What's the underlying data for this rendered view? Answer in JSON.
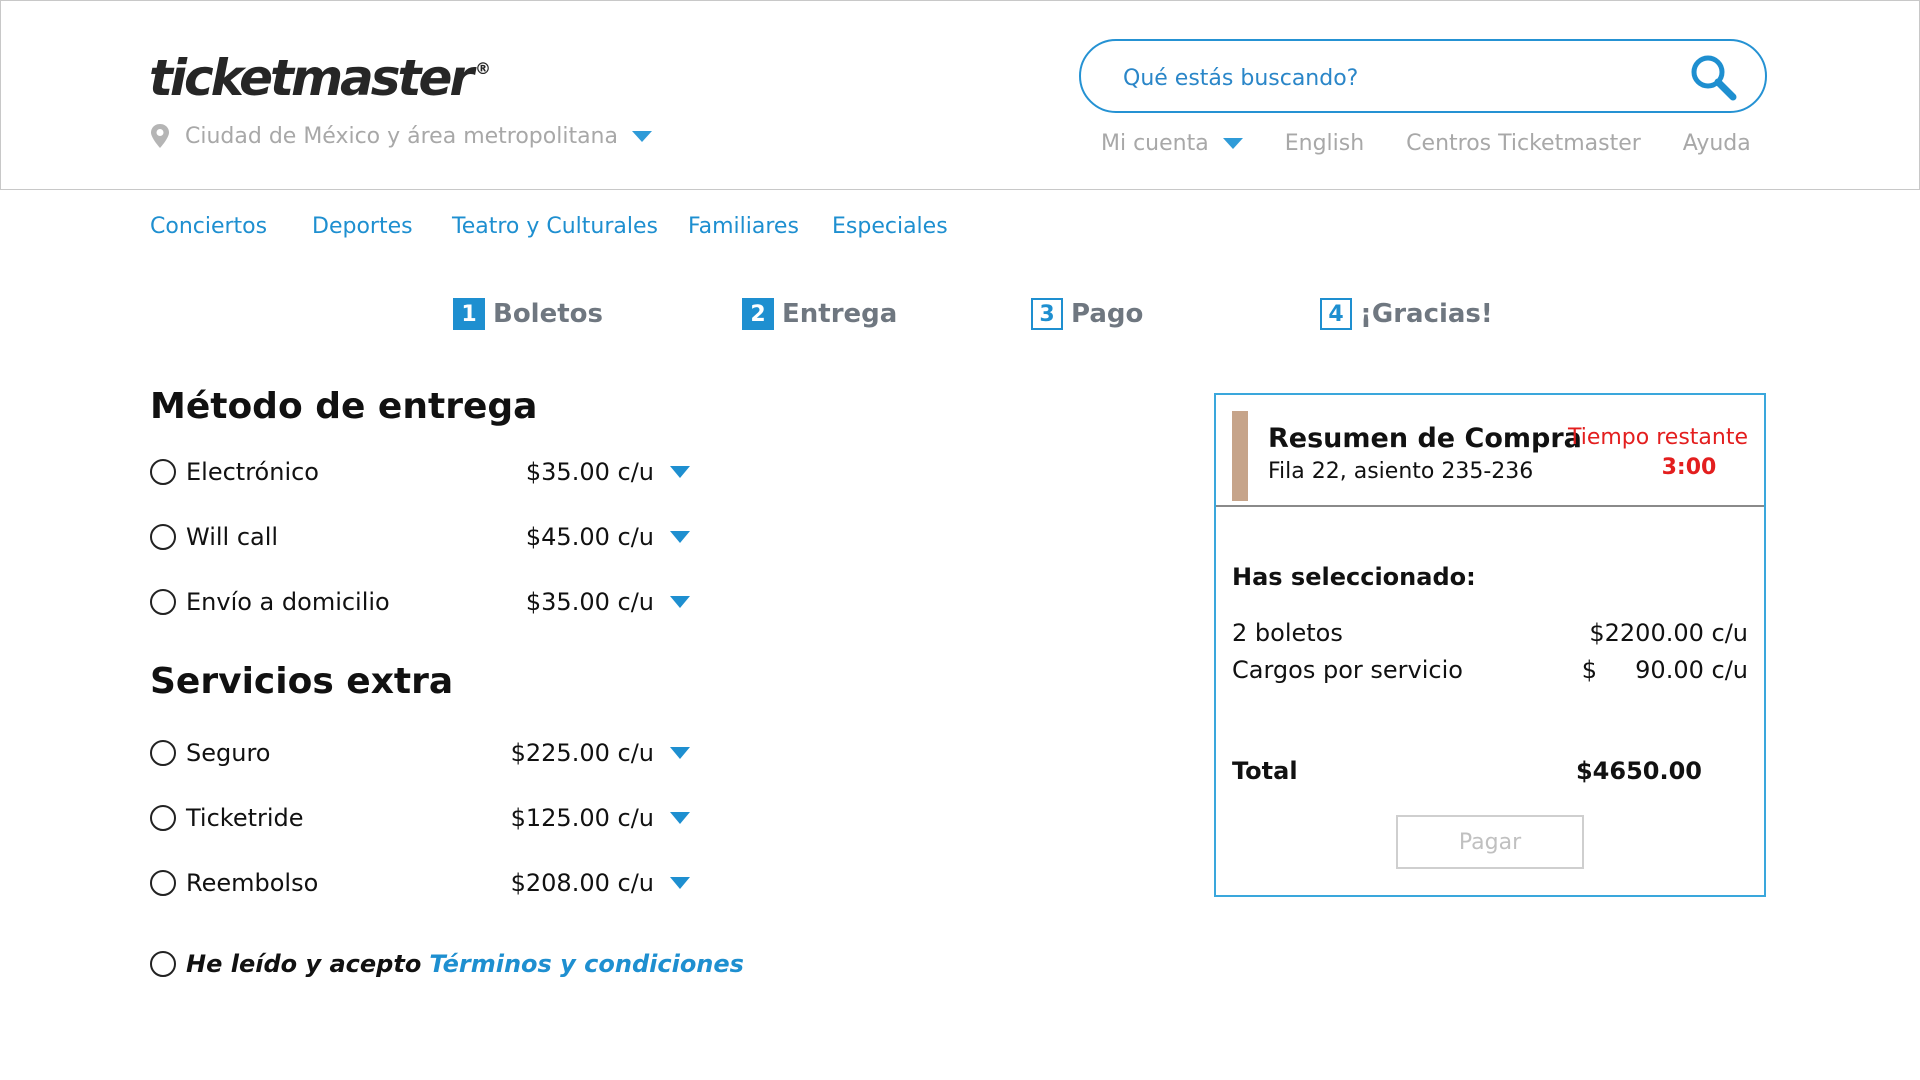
{
  "header": {
    "logo": "ticketmaster",
    "logo_reg": "®",
    "location": "Ciudad de México y área metropolitana",
    "search_placeholder": "Qué estás buscando?",
    "nav": {
      "account": "Mi cuenta",
      "language": "English",
      "centers": "Centros Ticketmaster",
      "help": "Ayuda"
    }
  },
  "categories": [
    "Conciertos",
    "Deportes",
    "Teatro y Culturales",
    "Familiares",
    "Especiales"
  ],
  "steps": [
    {
      "num": "1",
      "label": "Boletos",
      "active": true
    },
    {
      "num": "2",
      "label": "Entrega",
      "active": true
    },
    {
      "num": "3",
      "label": "Pago",
      "active": false
    },
    {
      "num": "4",
      "label": "¡Gracias!",
      "active": false
    }
  ],
  "delivery": {
    "title": "Método de entrega",
    "options": [
      {
        "label": "Electrónico",
        "price": "$35.00 c/u"
      },
      {
        "label": "Will call",
        "price": "$45.00 c/u"
      },
      {
        "label": "Envío a domicilio",
        "price": "$35.00 c/u"
      }
    ]
  },
  "extras": {
    "title": "Servicios extra",
    "options": [
      {
        "label": "Seguro",
        "price": "$225.00 c/u"
      },
      {
        "label": "Ticketride",
        "price": "$125.00 c/u"
      },
      {
        "label": "Reembolso",
        "price": "$208.00 c/u"
      }
    ]
  },
  "terms": {
    "text": "He leído y acepto",
    "link": "Términos y condiciones"
  },
  "summary": {
    "title": "Resumen de Compra",
    "seat": "Fila 22, asiento 235-236",
    "timer_label": "Tiempo restante",
    "timer_value": "3:00",
    "selected_title": "Has seleccionado:",
    "rows": [
      {
        "label": "2 boletos",
        "value": "$2200.00 c/u"
      },
      {
        "label": "Cargos por servicio",
        "value": "$     90.00 c/u"
      }
    ],
    "total_label": "Total",
    "total_value": "$4650.00",
    "pay_label": "Pagar"
  },
  "colors": {
    "accent": "#1e8fd0",
    "timer": "#e31e1e",
    "summary_bar": "#c6a48a"
  }
}
